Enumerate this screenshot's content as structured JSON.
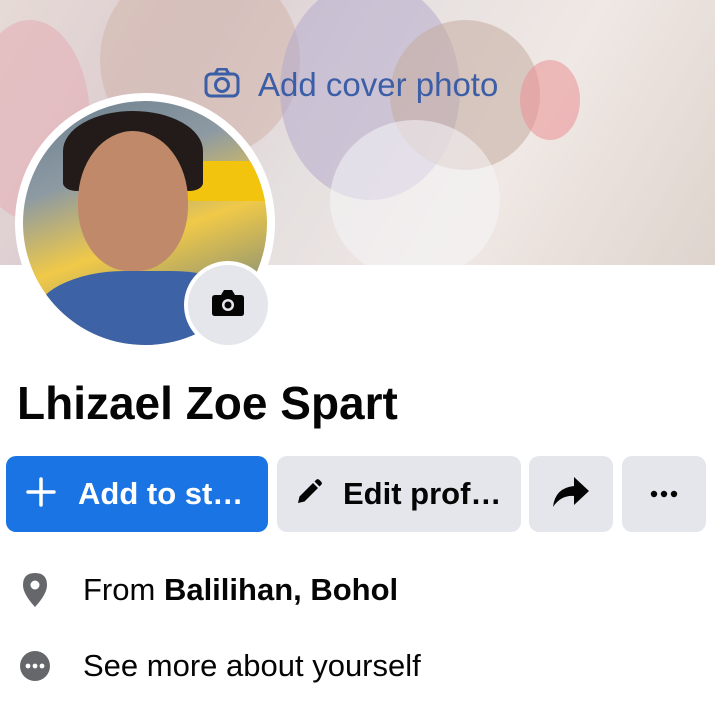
{
  "cover": {
    "add_label": "Add cover photo"
  },
  "profile": {
    "name": "Lhizael Zoe Spart"
  },
  "actions": {
    "add_story_label": "Add to st…",
    "edit_profile_label": "Edit prof…"
  },
  "details": {
    "from_prefix": "From ",
    "from_place": "Balilihan, Bohol",
    "see_more": "See more about yourself"
  },
  "colors": {
    "primary_button": "#1b74e4",
    "secondary_button": "#e4e6eb",
    "cover_link": "#3c5ea6",
    "icon_gray": "#65676b"
  },
  "icons": {
    "cover_camera": "camera-icon",
    "avatar_camera": "camera-icon",
    "add": "plus-icon",
    "edit": "pencil-icon",
    "share": "share-arrow-icon",
    "more": "ellipsis-icon",
    "location": "location-pin-icon",
    "see_more": "ellipsis-circle-icon"
  }
}
